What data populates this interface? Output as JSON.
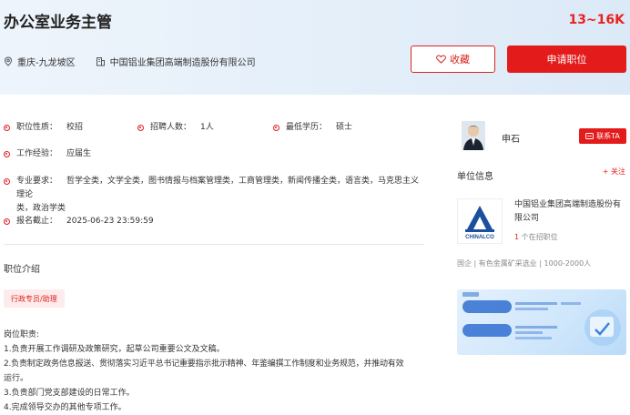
{
  "job": {
    "title": "办公室业务主管",
    "salary": "13~16K",
    "location": "重庆-九龙坡区",
    "company": "中国铝业集团高端制造股份有限公司"
  },
  "actions": {
    "favorite_label": "收藏",
    "apply_label": "申请职位"
  },
  "details": {
    "nature_label": "职位性质：",
    "nature_value": "校招",
    "headcount_label": "招聘人数：",
    "headcount_value": "1人",
    "education_label": "最低学历：",
    "education_value": "硕士",
    "experience_label": "工作经验：",
    "experience_value": "应届生",
    "major_label": "专业要求：",
    "major_value_line1": "哲学全类，文学全类，图书情报与档案管理类，工商管理类，新闻传播全类，语言类，马克思主义理论",
    "major_value_line2": "类，政治学类",
    "deadline_label": "报名截止：",
    "deadline_value": "2025-06-23 23:59:59"
  },
  "intro": {
    "section_title": "职位介绍",
    "tag": "行政专员/助理",
    "lines": [
      "岗位职责:",
      "1.负责开展工作调研及政策研究，起草公司重要公文及文稿。",
      "2.负责制定政务信息报送、贯彻落实习近平总书记重要指示批示精神、年鉴编撰工作制度和业务规范，并推动有效",
      "运行。",
      "3.负责部门党支部建设的日常工作。",
      "4.完成领导交办的其他专项工作。"
    ]
  },
  "recruiter": {
    "name": "申石",
    "contact_label": "联系TA"
  },
  "unit": {
    "title": "单位信息",
    "follow_label": "+ 关注",
    "company_name": "中国铝业集团高端制造股份有限公司",
    "jobs_count": "1",
    "jobs_suffix": "个在招职位",
    "industry": "国企 | 有色金属矿采选业 | 1000-2000人",
    "logo_text": "CHINALCO"
  },
  "colors": {
    "accent": "#e31b1b"
  }
}
